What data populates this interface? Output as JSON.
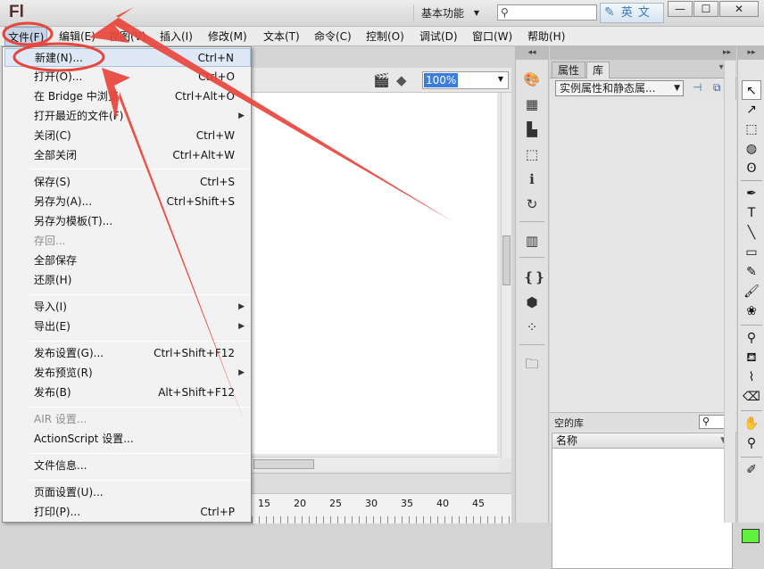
{
  "app": {
    "logo": "Fl",
    "workspace": "基本功能",
    "badge_text": "英 文"
  },
  "menubar": [
    "文件(F)",
    "编辑(E)",
    "视图(V)",
    "插入(I)",
    "修改(M)",
    "文本(T)",
    "命令(C)",
    "控制(O)",
    "调试(D)",
    "窗口(W)",
    "帮助(H)"
  ],
  "zoom": "100%",
  "file_menu": {
    "items": [
      {
        "label": "新建(N)...",
        "shortcut": "Ctrl+N",
        "highlight": true
      },
      {
        "label": "打开(O)...",
        "shortcut": "Ctrl+O"
      },
      {
        "label": "在 Bridge 中浏览",
        "shortcut": "Ctrl+Alt+O"
      },
      {
        "label": "打开最近的文件(F)",
        "submenu": true
      },
      {
        "label": "关闭(C)",
        "shortcut": "Ctrl+W"
      },
      {
        "label": "全部关闭",
        "shortcut": "Ctrl+Alt+W"
      },
      {
        "label": "保存(S)",
        "shortcut": "Ctrl+S"
      },
      {
        "label": "另存为(A)...",
        "shortcut": "Ctrl+Shift+S"
      },
      {
        "label": "另存为模板(T)..."
      },
      {
        "label": "存回...",
        "disabled": true
      },
      {
        "label": "全部保存"
      },
      {
        "label": "还原(H)"
      },
      {
        "label": "导入(I)",
        "submenu": true
      },
      {
        "label": "导出(E)",
        "submenu": true
      },
      {
        "label": "发布设置(G)...",
        "shortcut": "Ctrl+Shift+F12"
      },
      {
        "label": "发布预览(R)",
        "submenu": true
      },
      {
        "label": "发布(B)",
        "shortcut": "Alt+Shift+F12"
      },
      {
        "label": "AIR 设置...",
        "disabled": true
      },
      {
        "label": "ActionScript 设置..."
      },
      {
        "label": "文件信息..."
      },
      {
        "label": "页面设置(U)..."
      },
      {
        "label": "打印(P)...",
        "shortcut": "Ctrl+P"
      }
    ]
  },
  "timeline_numbers": [
    "15",
    "20",
    "25",
    "30",
    "35",
    "40",
    "45"
  ],
  "right_panel": {
    "tabs": [
      "属性",
      "库"
    ],
    "library_select": "实例属性和静态属...",
    "empty_library": "空的库",
    "column_header": "名称"
  },
  "icons": {
    "search": "search-icon",
    "minimize": "minimize-icon",
    "maximize": "maximize-icon",
    "close": "close-icon"
  },
  "colors": {
    "fill_color": "#5ef03c",
    "annotation": "#e8453c",
    "zoom_highlight": "#3c7be0"
  }
}
